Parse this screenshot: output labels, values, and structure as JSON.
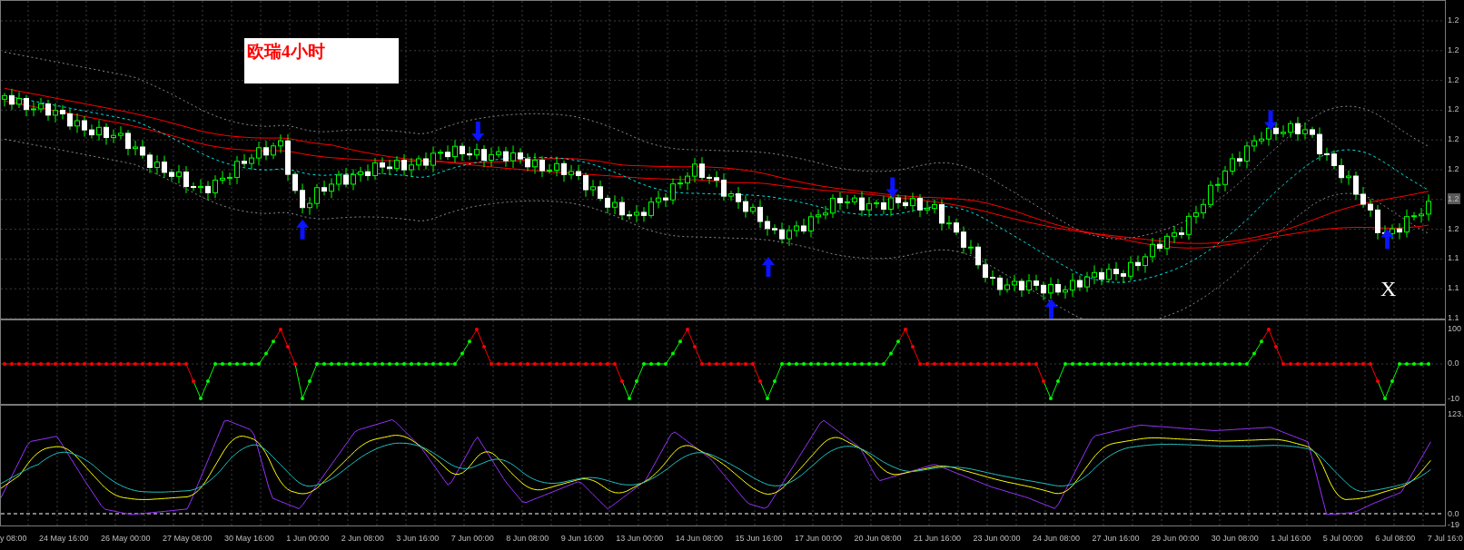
{
  "chart_label": "欧瑞4小时",
  "marker": "X",
  "price_axis": [
    {
      "text": "1.2",
      "current": false
    },
    {
      "text": "1.2",
      "current": false
    },
    {
      "text": "1.2",
      "current": false
    },
    {
      "text": "1.2",
      "current": false
    },
    {
      "text": "1.2",
      "current": false
    },
    {
      "text": "1.2",
      "current": false
    },
    {
      "text": "1.2",
      "current": true
    },
    {
      "text": "1.2",
      "current": false
    },
    {
      "text": "1.1",
      "current": false
    },
    {
      "text": "1.1",
      "current": false
    },
    {
      "text": "1.1",
      "current": false
    }
  ],
  "signals": [
    {
      "kind": "up"
    },
    {
      "kind": "down"
    },
    {
      "kind": "up"
    },
    {
      "kind": "down"
    },
    {
      "kind": "up"
    },
    {
      "kind": "down"
    },
    {
      "kind": "up"
    }
  ],
  "indicator_axis": [
    "100",
    "0.0",
    "-10"
  ],
  "oscillator_axis": [
    "123.",
    "0.0",
    "-19"
  ],
  "time_axis": [
    "y 08:00",
    "24 May 16:00",
    "26 May 00:00",
    "27 May 08:00",
    "30 May 16:00",
    "1 Jun 00:00",
    "2 Jun 08:00",
    "3 Jun 16:00",
    "7 Jun 00:00",
    "8 Jun 08:00",
    "9 Jun 16:00",
    "13 Jun 00:00",
    "14 Jun 08:00",
    "15 Jun 16:00",
    "17 Jun 00:00",
    "20 Jun 08:00",
    "21 Jun 16:00",
    "23 Jun 00:00",
    "24 Jun 08:00",
    "27 Jun 16:00",
    "29 Jun 00:00",
    "30 Jun 08:00",
    "1 Jul 16:00",
    "5 Jul 00:00",
    "6 Jul 08:00",
    "7 Jul 16:0"
  ]
}
